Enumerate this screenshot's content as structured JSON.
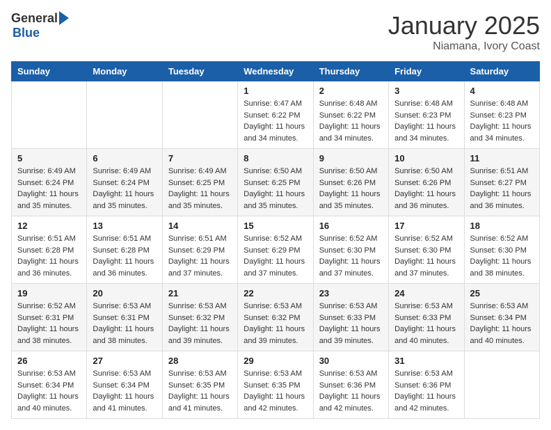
{
  "header": {
    "logo_general": "General",
    "logo_blue": "Blue",
    "month": "January 2025",
    "location": "Niamana, Ivory Coast"
  },
  "days_of_week": [
    "Sunday",
    "Monday",
    "Tuesday",
    "Wednesday",
    "Thursday",
    "Friday",
    "Saturday"
  ],
  "weeks": [
    [
      {
        "day": "",
        "info": ""
      },
      {
        "day": "",
        "info": ""
      },
      {
        "day": "",
        "info": ""
      },
      {
        "day": "1",
        "info": "Sunrise: 6:47 AM\nSunset: 6:22 PM\nDaylight: 11 hours\nand 34 minutes."
      },
      {
        "day": "2",
        "info": "Sunrise: 6:48 AM\nSunset: 6:22 PM\nDaylight: 11 hours\nand 34 minutes."
      },
      {
        "day": "3",
        "info": "Sunrise: 6:48 AM\nSunset: 6:23 PM\nDaylight: 11 hours\nand 34 minutes."
      },
      {
        "day": "4",
        "info": "Sunrise: 6:48 AM\nSunset: 6:23 PM\nDaylight: 11 hours\nand 34 minutes."
      }
    ],
    [
      {
        "day": "5",
        "info": "Sunrise: 6:49 AM\nSunset: 6:24 PM\nDaylight: 11 hours\nand 35 minutes."
      },
      {
        "day": "6",
        "info": "Sunrise: 6:49 AM\nSunset: 6:24 PM\nDaylight: 11 hours\nand 35 minutes."
      },
      {
        "day": "7",
        "info": "Sunrise: 6:49 AM\nSunset: 6:25 PM\nDaylight: 11 hours\nand 35 minutes."
      },
      {
        "day": "8",
        "info": "Sunrise: 6:50 AM\nSunset: 6:25 PM\nDaylight: 11 hours\nand 35 minutes."
      },
      {
        "day": "9",
        "info": "Sunrise: 6:50 AM\nSunset: 6:26 PM\nDaylight: 11 hours\nand 35 minutes."
      },
      {
        "day": "10",
        "info": "Sunrise: 6:50 AM\nSunset: 6:26 PM\nDaylight: 11 hours\nand 36 minutes."
      },
      {
        "day": "11",
        "info": "Sunrise: 6:51 AM\nSunset: 6:27 PM\nDaylight: 11 hours\nand 36 minutes."
      }
    ],
    [
      {
        "day": "12",
        "info": "Sunrise: 6:51 AM\nSunset: 6:28 PM\nDaylight: 11 hours\nand 36 minutes."
      },
      {
        "day": "13",
        "info": "Sunrise: 6:51 AM\nSunset: 6:28 PM\nDaylight: 11 hours\nand 36 minutes."
      },
      {
        "day": "14",
        "info": "Sunrise: 6:51 AM\nSunset: 6:29 PM\nDaylight: 11 hours\nand 37 minutes."
      },
      {
        "day": "15",
        "info": "Sunrise: 6:52 AM\nSunset: 6:29 PM\nDaylight: 11 hours\nand 37 minutes."
      },
      {
        "day": "16",
        "info": "Sunrise: 6:52 AM\nSunset: 6:30 PM\nDaylight: 11 hours\nand 37 minutes."
      },
      {
        "day": "17",
        "info": "Sunrise: 6:52 AM\nSunset: 6:30 PM\nDaylight: 11 hours\nand 37 minutes."
      },
      {
        "day": "18",
        "info": "Sunrise: 6:52 AM\nSunset: 6:30 PM\nDaylight: 11 hours\nand 38 minutes."
      }
    ],
    [
      {
        "day": "19",
        "info": "Sunrise: 6:52 AM\nSunset: 6:31 PM\nDaylight: 11 hours\nand 38 minutes."
      },
      {
        "day": "20",
        "info": "Sunrise: 6:53 AM\nSunset: 6:31 PM\nDaylight: 11 hours\nand 38 minutes."
      },
      {
        "day": "21",
        "info": "Sunrise: 6:53 AM\nSunset: 6:32 PM\nDaylight: 11 hours\nand 39 minutes."
      },
      {
        "day": "22",
        "info": "Sunrise: 6:53 AM\nSunset: 6:32 PM\nDaylight: 11 hours\nand 39 minutes."
      },
      {
        "day": "23",
        "info": "Sunrise: 6:53 AM\nSunset: 6:33 PM\nDaylight: 11 hours\nand 39 minutes."
      },
      {
        "day": "24",
        "info": "Sunrise: 6:53 AM\nSunset: 6:33 PM\nDaylight: 11 hours\nand 40 minutes."
      },
      {
        "day": "25",
        "info": "Sunrise: 6:53 AM\nSunset: 6:34 PM\nDaylight: 11 hours\nand 40 minutes."
      }
    ],
    [
      {
        "day": "26",
        "info": "Sunrise: 6:53 AM\nSunset: 6:34 PM\nDaylight: 11 hours\nand 40 minutes."
      },
      {
        "day": "27",
        "info": "Sunrise: 6:53 AM\nSunset: 6:34 PM\nDaylight: 11 hours\nand 41 minutes."
      },
      {
        "day": "28",
        "info": "Sunrise: 6:53 AM\nSunset: 6:35 PM\nDaylight: 11 hours\nand 41 minutes."
      },
      {
        "day": "29",
        "info": "Sunrise: 6:53 AM\nSunset: 6:35 PM\nDaylight: 11 hours\nand 42 minutes."
      },
      {
        "day": "30",
        "info": "Sunrise: 6:53 AM\nSunset: 6:36 PM\nDaylight: 11 hours\nand 42 minutes."
      },
      {
        "day": "31",
        "info": "Sunrise: 6:53 AM\nSunset: 6:36 PM\nDaylight: 11 hours\nand 42 minutes."
      },
      {
        "day": "",
        "info": ""
      }
    ]
  ]
}
